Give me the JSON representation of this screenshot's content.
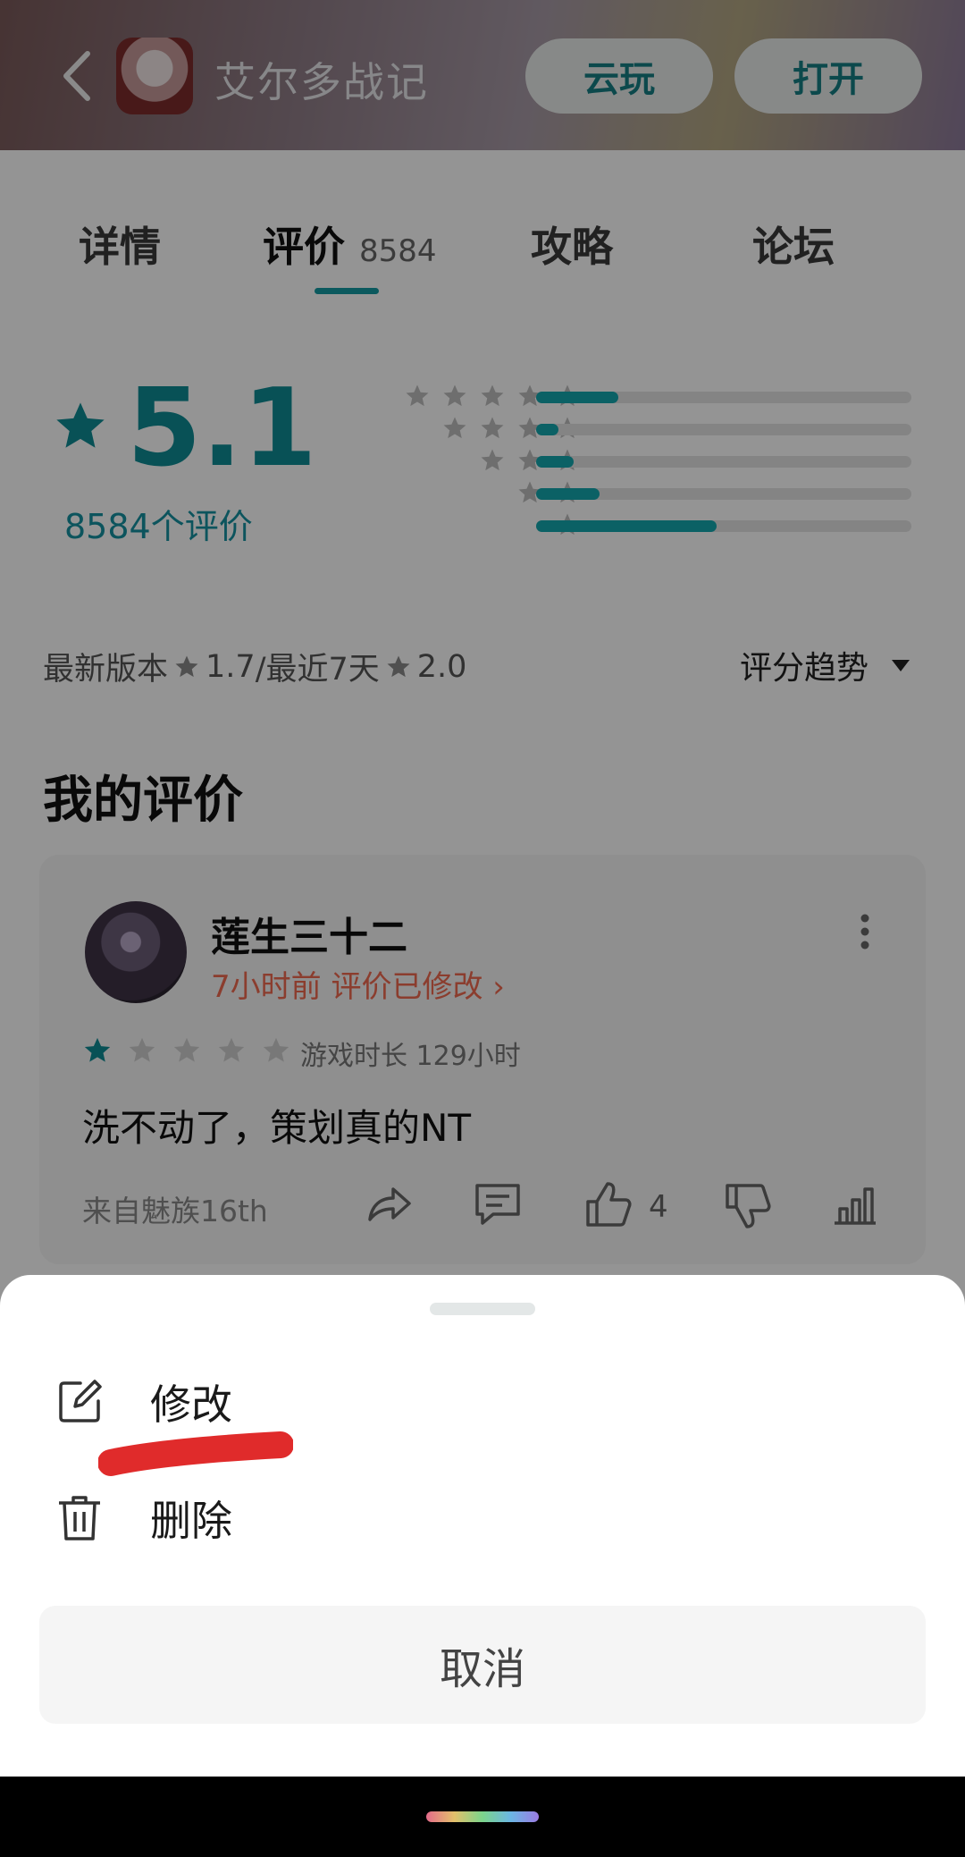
{
  "header": {
    "back_icon": "chevron-left-icon",
    "app_title": "艾尔多战记",
    "cloud_play": "云玩",
    "open": "打开"
  },
  "tabs": [
    {
      "label": "详情"
    },
    {
      "label": "评价",
      "count": "8584",
      "active": true
    },
    {
      "label": "攻略"
    },
    {
      "label": "论坛"
    }
  ],
  "rating": {
    "score": "5.1",
    "count_text": "8584个评价",
    "distribution": [
      {
        "stars": 5,
        "fraction": 0.22
      },
      {
        "stars": 4,
        "fraction": 0.06
      },
      {
        "stars": 3,
        "fraction": 0.1
      },
      {
        "stars": 2,
        "fraction": 0.17
      },
      {
        "stars": 1,
        "fraction": 0.48
      }
    ],
    "accent_color": "#13a7ae"
  },
  "version": {
    "label": "最新版本",
    "latest_score": "1.7",
    "recent_label": "/最近7天",
    "recent_score": "2.0",
    "trend_label": "评分趋势"
  },
  "my_review": {
    "section_title": "我的评价",
    "username": "莲生三十二",
    "meta": "7小时前 评价已修改 ›",
    "stars": 1,
    "playtime": "游戏时长 129小时",
    "text": "洗不动了，策划真的NT",
    "device": "来自魅族16th",
    "likes": "4"
  },
  "sheet": {
    "edit_label": "修改",
    "delete_label": "删除",
    "cancel_label": "取消"
  }
}
